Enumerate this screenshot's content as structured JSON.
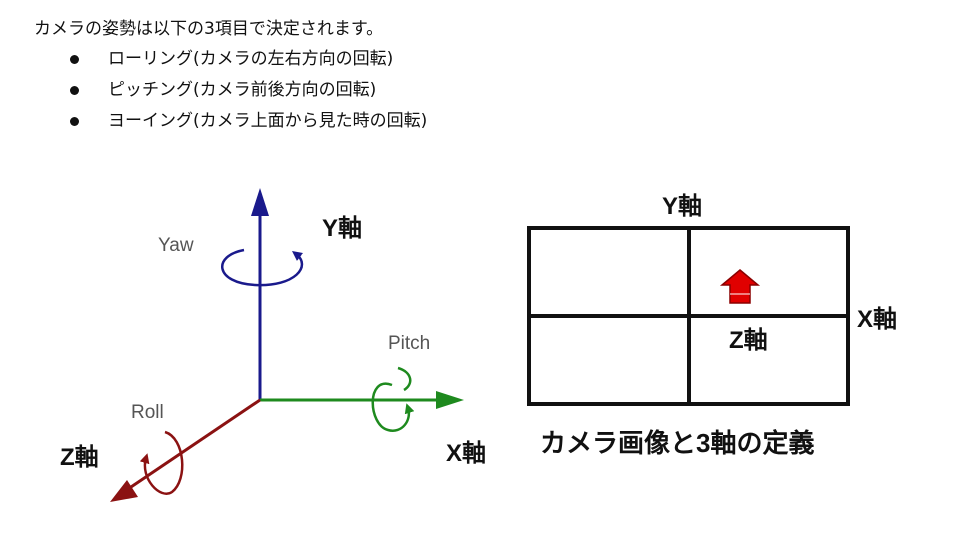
{
  "intro": "カメラの姿勢は以下の3項目で決定されます。",
  "bullets": [
    "ローリング(カメラの左右方向の回転)",
    "ピッチング(カメラ前後方向の回転)",
    "ヨーイング(カメラ上面から見た時の回転)"
  ],
  "left_diagram": {
    "y_axis": "Y軸",
    "x_axis": "X軸",
    "z_axis": "Z軸",
    "yaw": "Yaw",
    "pitch": "Pitch",
    "roll": "Roll",
    "colors": {
      "y": "#1a1a8c",
      "x": "#1e8a1e",
      "z": "#8b1212"
    }
  },
  "right_diagram": {
    "y_axis": "Y軸",
    "x_axis": "X軸",
    "z_axis": "Z軸",
    "caption": "カメラ画像と3軸の定義",
    "arrow_color": "#e00000"
  }
}
